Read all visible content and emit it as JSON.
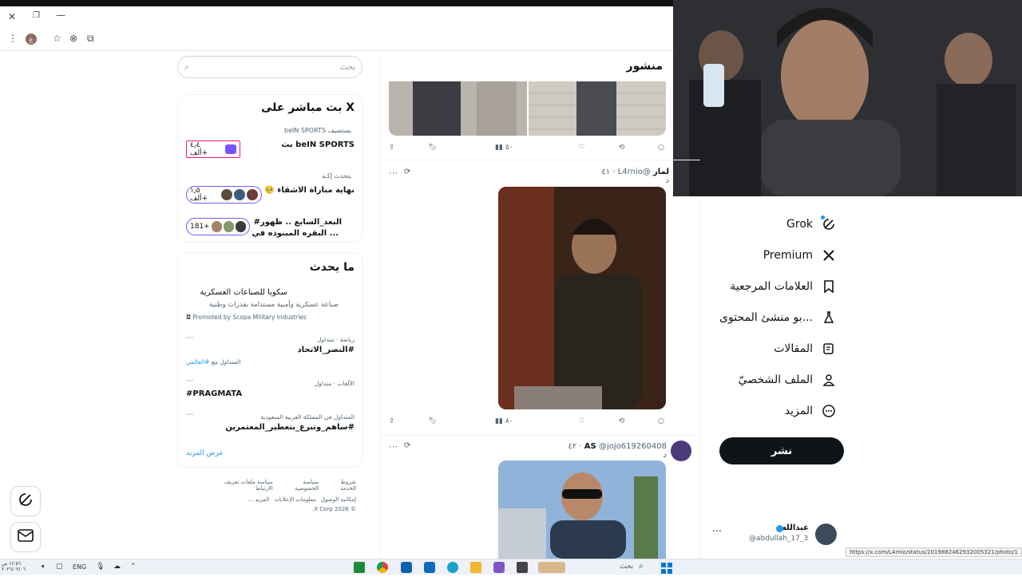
{
  "browser": {
    "window_controls": [
      "✕",
      "❐",
      "—"
    ],
    "profile_badge": "ع"
  },
  "feed": {
    "header_title": "منشور",
    "post1": {
      "views": "٥٠"
    },
    "post2": {
      "author_name": "لمار",
      "author_handle": "@L4rnio",
      "time": "٤١ د",
      "views": "٨٠"
    },
    "post3": {
      "author_name": "AS",
      "author_handle": "@jojo619260408",
      "time": "٤٢ د"
    }
  },
  "right_nav": {
    "items": [
      {
        "label": "Grok",
        "icon": "grok-icon"
      },
      {
        "label": "Premium",
        "icon": "x-logo-icon"
      },
      {
        "label": "العلامات المرجعية",
        "icon": "bookmark-icon"
      },
      {
        "label": "...بو منشئ المحتوى",
        "icon": "flask-icon"
      },
      {
        "label": "المقالات",
        "icon": "article-icon"
      },
      {
        "label": "الملف الشخصيّ",
        "icon": "profile-icon"
      },
      {
        "label": "المزيد",
        "icon": "more-circle-icon"
      }
    ],
    "post_button": "نشر",
    "account": {
      "name": "عبدالله",
      "handle": "@abdullah_17_3"
    }
  },
  "sidebar": {
    "search_placeholder": "بحث",
    "live": {
      "title": "X بث مباشر على",
      "host_line": "يستضيف beIN SPORTS",
      "stream_title": "beIN SPORTS بث",
      "stream_count": "٤٫٤ ألف+",
      "talk_line": "يتحدث إكـه",
      "talk_title": "نهاية مباراة الاشقاء 🥺",
      "talk_count": "١٫٥ ألف+",
      "third_title_line1": "البعد_السابع .. ظهور#",
      "third_title_line2": "... البقره المبنوذه في",
      "third_count": "181+"
    },
    "happening": {
      "title": "ما يحدث",
      "promo_title": "سكوبا للصناعات العسكرية",
      "promo_desc": "صناعة عسكرية وأمنية مستدامة بقدرات وطنية",
      "promo_by": "Promoted by Scopa Military Industries",
      "trends": [
        {
          "category": "رياضة · متداول",
          "name": "#النصر_الاتحاد",
          "extra_label": "المتداول مع",
          "extra_tag": "#العالمي"
        },
        {
          "category": "الألعاب · متداول",
          "name": "#PRAGMATA"
        },
        {
          "category": "المتداول في المملكة العربية السعودية",
          "name": "#ساهم_وتبرع_بتعطير_المعتمرين"
        }
      ],
      "show_more": "عرض المزيد"
    },
    "footer": {
      "line1": [
        "شروط الخدمة",
        "سياسة الخصوصية",
        "سياسة ملفات تعريف الارتباط"
      ],
      "line2": [
        "إمكانية الوصول",
        "معلومات الإعلانات",
        "المزيد ..."
      ],
      "copyright": "© 2026 X Corp."
    }
  },
  "status_url": "https://x.com/L4rnio/status/2019882462932005321/photo/1",
  "taskbar": {
    "time": "١٢:٥٦ ص",
    "date": "٢٠٢٦/٠٢/٠٦",
    "lang": "ENG",
    "search_placeholder": "بحث"
  },
  "colors": {
    "accent": "#1d9bf0",
    "spaces_purple": "#7856ff",
    "post_button": "#0f1419"
  }
}
